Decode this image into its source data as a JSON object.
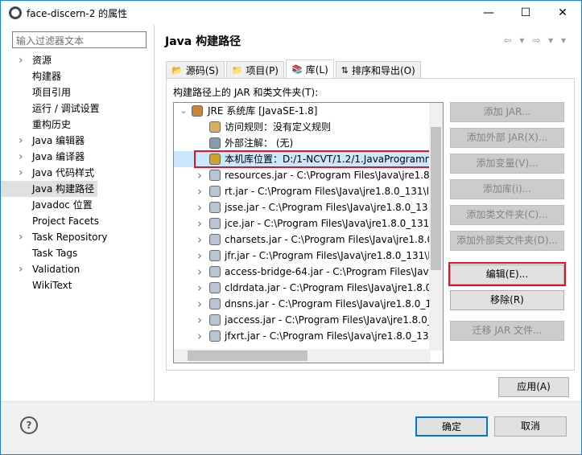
{
  "window": {
    "title": "face-discern-2 的属性",
    "minimize": "—",
    "maximize": "☐",
    "close": "✕"
  },
  "sidebar": {
    "filter_placeholder": "输入过滤器文本",
    "items": [
      {
        "label": "资源",
        "expandable": true
      },
      {
        "label": "构建器",
        "expandable": false
      },
      {
        "label": "项目引用",
        "expandable": false
      },
      {
        "label": "运行 / 调试设置",
        "expandable": false
      },
      {
        "label": "重构历史",
        "expandable": false
      },
      {
        "label": "Java 编辑器",
        "expandable": true
      },
      {
        "label": "Java 编译器",
        "expandable": true
      },
      {
        "label": "Java 代码样式",
        "expandable": true
      },
      {
        "label": "Java 构建路径",
        "expandable": false,
        "selected": true
      },
      {
        "label": "Javadoc 位置",
        "expandable": false
      },
      {
        "label": "Project Facets",
        "expandable": false
      },
      {
        "label": "Task Repository",
        "expandable": true
      },
      {
        "label": "Task Tags",
        "expandable": false
      },
      {
        "label": "Validation",
        "expandable": true
      },
      {
        "label": "WikiText",
        "expandable": false
      }
    ]
  },
  "main": {
    "title": "Java 构建路径",
    "nav_arrows": "⇦ ▾ ⇨ ▾ ▾",
    "tabs": [
      {
        "label": "源码(S)",
        "icon": "folder-source-icon"
      },
      {
        "label": "项目(P)",
        "icon": "project-icon"
      },
      {
        "label": "库(L)",
        "icon": "library-icon",
        "active": true
      },
      {
        "label": "排序和导出(O)",
        "icon": "order-icon"
      }
    ],
    "list_label": "构建路径上的 JAR 和类文件夹(T):",
    "tree": [
      {
        "text": "JRE 系统库 [JavaSE-1.8]",
        "level": 0,
        "expander": "⌄",
        "icon": "library-icon"
      },
      {
        "text": "访问规则：没有定义规则",
        "level": 1,
        "icon": "access-rules-icon"
      },
      {
        "text": "外部注解： (无)",
        "level": 1,
        "icon": "annotation-icon"
      },
      {
        "text": "本机库位置：D:/1-NCVT/1.2/1.JavaProgramm",
        "level": 1,
        "icon": "native-library-icon",
        "selected": true
      },
      {
        "text": "resources.jar - C:\\Program Files\\Java\\jre1.8",
        "level": 1,
        "expander": "›",
        "icon": "jar-icon"
      },
      {
        "text": "rt.jar - C:\\Program Files\\Java\\jre1.8.0_131\\li",
        "level": 1,
        "expander": "›",
        "icon": "jar-icon"
      },
      {
        "text": "jsse.jar - C:\\Program Files\\Java\\jre1.8.0_131",
        "level": 1,
        "expander": "›",
        "icon": "jar-icon"
      },
      {
        "text": "jce.jar - C:\\Program Files\\Java\\jre1.8.0_131\\",
        "level": 1,
        "expander": "›",
        "icon": "jar-icon"
      },
      {
        "text": "charsets.jar - C:\\Program Files\\Java\\jre1.8.0",
        "level": 1,
        "expander": "›",
        "icon": "jar-icon"
      },
      {
        "text": "jfr.jar - C:\\Program Files\\Java\\jre1.8.0_131\\l",
        "level": 1,
        "expander": "›",
        "icon": "jar-icon"
      },
      {
        "text": "access-bridge-64.jar - C:\\Program Files\\Jav",
        "level": 1,
        "expander": "›",
        "icon": "jar-icon"
      },
      {
        "text": "cldrdata.jar - C:\\Program Files\\Java\\jre1.8.0",
        "level": 1,
        "expander": "›",
        "icon": "jar-icon"
      },
      {
        "text": "dnsns.jar - C:\\Program Files\\Java\\jre1.8.0_1",
        "level": 1,
        "expander": "›",
        "icon": "jar-icon"
      },
      {
        "text": "jaccess.jar - C:\\Program Files\\Java\\jre1.8.0_",
        "level": 1,
        "expander": "›",
        "icon": "jar-icon"
      },
      {
        "text": "jfxrt.jar - C:\\Program Files\\Java\\jre1.8.0_131",
        "level": 1,
        "expander": "›",
        "icon": "jar-icon"
      }
    ],
    "buttons": [
      {
        "label": "添加 JAR...",
        "enabled": false
      },
      {
        "label": "添加外部 JAR(X)...",
        "enabled": false
      },
      {
        "label": "添加变量(V)...",
        "enabled": false
      },
      {
        "label": "添加库(i)...",
        "enabled": false
      },
      {
        "label": "添加类文件夹(C)...",
        "enabled": false
      },
      {
        "label": "添加外部类文件夹(D)...",
        "enabled": false
      },
      {
        "label": "编辑(E)...",
        "enabled": true,
        "highlighted": true
      },
      {
        "label": "移除(R)",
        "enabled": true
      },
      {
        "label": "迁移 JAR 文件...",
        "enabled": false
      }
    ],
    "apply": "应用(A)"
  },
  "footer": {
    "help": "?",
    "ok": "确定",
    "cancel": "取消"
  },
  "colors": {
    "highlight_box": "#e81123",
    "selection": "#cce8ff",
    "default_button_border": "#0078d7"
  }
}
